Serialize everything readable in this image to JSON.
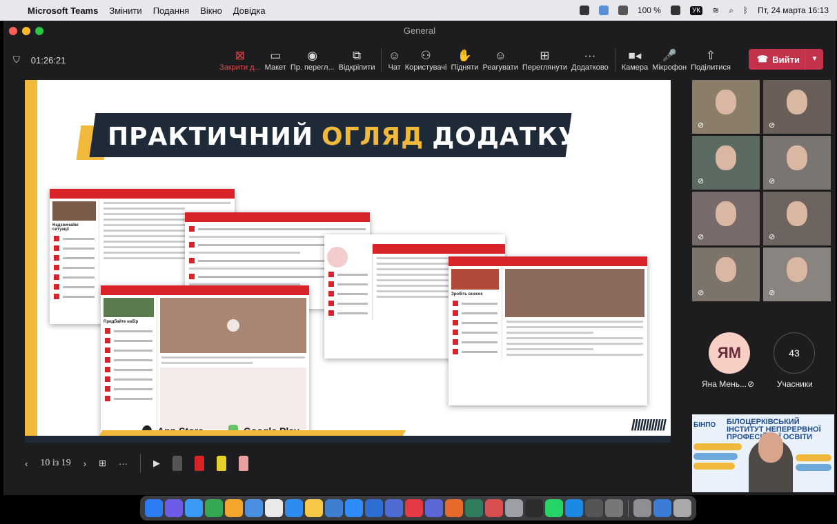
{
  "menubar": {
    "app": "Microsoft Teams",
    "items": [
      "Змінити",
      "Подання",
      "Вікно",
      "Довідка"
    ],
    "battery": "100 %",
    "keyboard": "УК",
    "datetime": "Пт, 24 марта 16:13"
  },
  "window": {
    "title": "General"
  },
  "toolbar": {
    "timer": "01:26:21",
    "buttons": [
      {
        "label": "Закрити д...",
        "icon": "close-share-icon",
        "glyph": "⊠",
        "red": true
      },
      {
        "label": "Макет",
        "icon": "layout-icon",
        "glyph": "▭"
      },
      {
        "label": "Пр. перегл...",
        "icon": "eye-icon",
        "glyph": "◉"
      },
      {
        "label": "Відкріпити",
        "icon": "popout-icon",
        "glyph": "⧉"
      }
    ],
    "buttons2": [
      {
        "label": "Чат",
        "icon": "chat-icon",
        "glyph": "☺"
      },
      {
        "label": "Користувачі",
        "icon": "people-icon",
        "glyph": "⚇"
      },
      {
        "label": "Підняти",
        "icon": "raise-hand-icon",
        "glyph": "✋"
      },
      {
        "label": "Реагувати",
        "icon": "react-icon",
        "glyph": "☺"
      },
      {
        "label": "Переглянути",
        "icon": "grid-view-icon",
        "glyph": "⊞"
      },
      {
        "label": "Додатково",
        "icon": "more-icon",
        "glyph": "···"
      }
    ],
    "buttons3": [
      {
        "label": "Камера",
        "icon": "camera-icon",
        "glyph": "■◂"
      },
      {
        "label": "Мікрофон",
        "icon": "microphone-icon",
        "glyph": "🎤"
      },
      {
        "label": "Поділитися",
        "icon": "share-icon",
        "glyph": "⇧"
      }
    ],
    "leave_label": "Вийти"
  },
  "slide": {
    "title_part1": "ПРАКТИЧНИЙ",
    "title_highlight": "ОГЛЯД",
    "title_part2": "ДОДАТКУ",
    "app_store": "App Store",
    "google_play": "Google Play",
    "panel_titles": [
      "Надзвичайні ситуації",
      "Придбайте набір",
      "Зробіть внесок"
    ],
    "hatch": "////////////"
  },
  "participants": {
    "avatar_initials": "ЯМ",
    "avatar_name": "Яна Мень...",
    "count": "43",
    "count_label": "Учасники"
  },
  "presenter_banner": {
    "org": "БІНПО",
    "title": "БІЛОЦЕРКІВСЬКИЙ ІНСТИТУТ НЕПЕРЕРВНОЇ ПРОФЕСІЙНОЇ ОСВІТИ"
  },
  "slide_nav": {
    "page": "10 із 19"
  },
  "colors": {
    "brand": "#d8232a",
    "accent": "#f0b93b",
    "navy": "#1f2a38",
    "leave": "#c4314b"
  }
}
